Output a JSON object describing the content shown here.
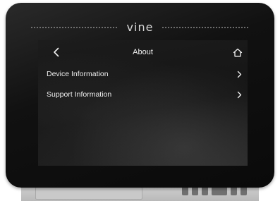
{
  "device": {
    "brand_logo": "vine",
    "screen": {
      "header": {
        "title": "About",
        "back_icon": "chevron-left-icon",
        "home_icon": "home-icon"
      },
      "menu_items": [
        {
          "label": "Device Information",
          "icon": "chevron-right-icon"
        },
        {
          "label": "Support Information",
          "icon": "chevron-right-icon"
        }
      ]
    }
  },
  "colors": {
    "bezel": "#111111",
    "screen_background": "#1a1a1a",
    "text": "#f2f2f2"
  }
}
